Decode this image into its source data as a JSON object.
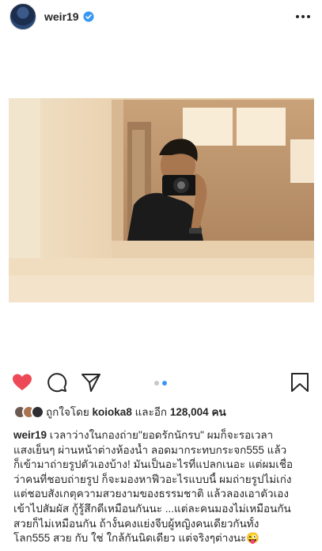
{
  "header": {
    "username": "weir19",
    "verified_icon": "verified-badge-icon",
    "more_icon": "more-dots-icon"
  },
  "post": {
    "photo_icon": "mirror-selfie-photo"
  },
  "actions": {
    "like_icon": "heart-filled-icon",
    "comment_icon": "comment-icon",
    "share_icon": "send-icon",
    "save_icon": "bookmark-icon",
    "carousel_total": 2,
    "carousel_active": 1,
    "like_color": "#ed4956",
    "dot_active_color": "#3897f0",
    "dot_inactive_color": "#c7c7c7"
  },
  "likes": {
    "prefix": "ถูกใจโดย",
    "user": "koioka8",
    "middle": "และอีก",
    "count": "128,004",
    "suffix": "คน"
  },
  "caption": {
    "username": "weir19",
    "first_line": " เวลาว่างในกองถ่าย\"ยอดรักนักรบ\" ผมก็จะรอเวลา",
    "lines": [
      "แสงเย็นๆ ผ่านหน้าต่างห้องน้ำ ลอดมากระทบกระจก555 แล้ว",
      "ก็เข้ามาถ่ายรูปตัวเองบ้าง! มันเป็นอะไรที่แปลกเนอะ แต่ผมเชื่อ",
      "ว่าคนที่ชอบถ่ายรูป ก็จะมองหาฟีวอะไรแบบนี้ ผมถ่ายรูปไม่เก่ง",
      "แต่ชอบสังเกตุความสวยงามของธรรมชาติ แล้วลองเอาตัวเอง",
      "เข้าไปสัมผัส กู้รู้สึกดีเหมือนกันนะ ...แต่ละคนมองไม่เหมือนกัน",
      "สวยก็ไม่เหมือนกัน ถ้างั้นคงแย่งจีบผู้หญิงคนเดียวกันทั้ง",
      "โลก555 สวย กับ ใช่ ใกล้กันนิดเดียว แต่จริงๆต่างนะ😜"
    ]
  }
}
